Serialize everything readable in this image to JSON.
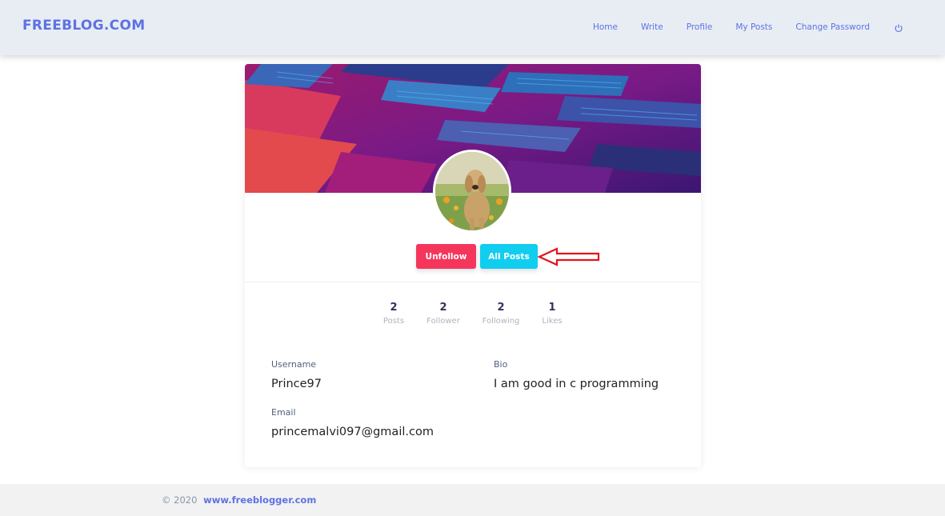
{
  "brand": "FREEBLOG.COM",
  "nav": {
    "items": [
      "Home",
      "Write",
      "Profile",
      "My Posts",
      "Change Password"
    ],
    "logout_icon": "power-icon"
  },
  "profile": {
    "buttons": {
      "unfollow": "Unfollow",
      "all_posts": "All Posts"
    },
    "stats": [
      {
        "value": "2",
        "label": "Posts"
      },
      {
        "value": "2",
        "label": "Follower"
      },
      {
        "value": "2",
        "label": "Following"
      },
      {
        "value": "1",
        "label": "Likes"
      }
    ],
    "fields": {
      "username_label": "Username",
      "username": "Prince97",
      "bio_label": "Bio",
      "bio": "I am good in c programming",
      "email_label": "Email",
      "email": "princemalvi097@gmail.com"
    }
  },
  "footer": {
    "copyright": "© 2020",
    "link": "www.freeblogger.com"
  },
  "colors": {
    "primary": "#5e72e4",
    "danger": "#f5365c",
    "info": "#11cdef",
    "annotation_arrow": "#e3141c"
  }
}
